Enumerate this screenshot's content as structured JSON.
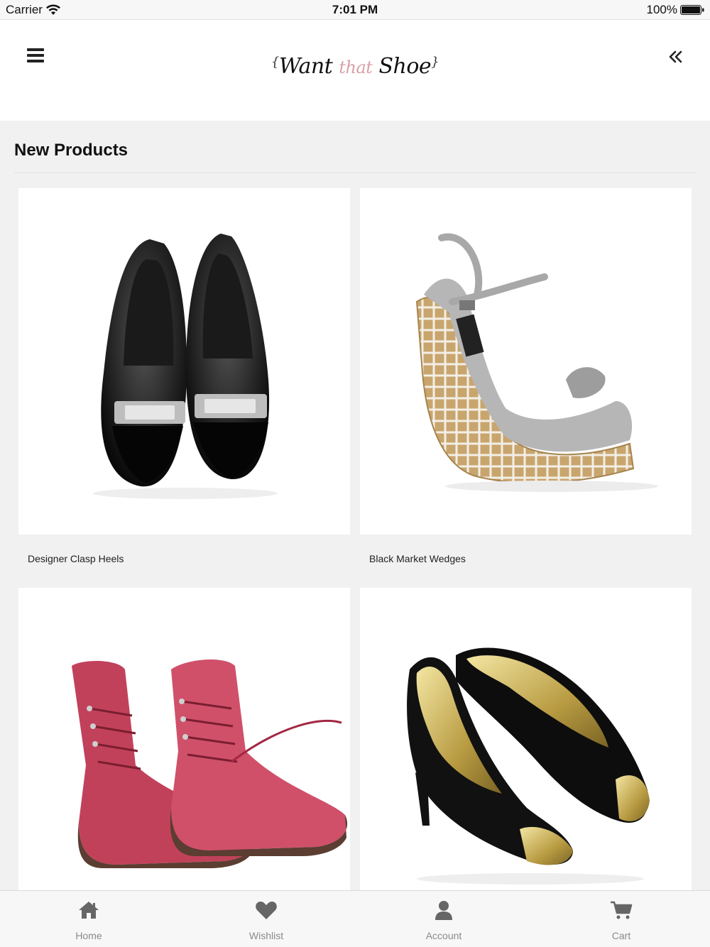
{
  "status_bar": {
    "carrier": "Carrier",
    "time": "7:01 PM",
    "battery": "100%"
  },
  "header": {
    "logo": {
      "part1": "Want",
      "part2": "that",
      "part3": "Shoe"
    },
    "accent_color": "#d9a0a8"
  },
  "section": {
    "title": "New Products"
  },
  "products": [
    {
      "name": "Designer Clasp Heels",
      "image": "black-clasp-heels"
    },
    {
      "name": "Black Market Wedges",
      "image": "grey-woven-wedges"
    },
    {
      "name": "",
      "image": "red-lace-up-boots"
    },
    {
      "name": "",
      "image": "black-gold-cap-pumps"
    }
  ],
  "tab_bar": {
    "items": [
      {
        "label": "Home",
        "icon": "home-icon"
      },
      {
        "label": "Wishlist",
        "icon": "heart-icon"
      },
      {
        "label": "Account",
        "icon": "user-icon"
      },
      {
        "label": "Cart",
        "icon": "cart-icon"
      }
    ],
    "label_color": "#8a8a8a",
    "icon_color": "#666666"
  }
}
